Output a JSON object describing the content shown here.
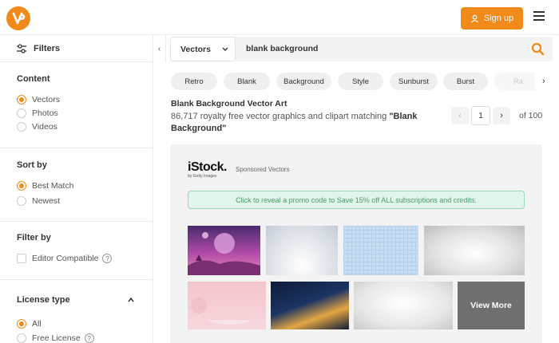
{
  "header": {
    "logo_icon": "vecteezy-v-logo-icon",
    "signup_label": "Sign up",
    "signup_icon": "user-icon",
    "menu_icon": "hamburger-menu-icon",
    "accent_color": "#f28a1a"
  },
  "sidebar": {
    "filters_label": "Filters",
    "collapse_icon": "chevron-left-icon",
    "content": {
      "title": "Content",
      "options": [
        {
          "label": "Vectors",
          "selected": true
        },
        {
          "label": "Photos",
          "selected": false
        },
        {
          "label": "Videos",
          "selected": false
        }
      ]
    },
    "sort": {
      "title": "Sort by",
      "options": [
        {
          "label": "Best Match",
          "selected": true
        },
        {
          "label": "Newest",
          "selected": false
        }
      ]
    },
    "filter_by": {
      "title": "Filter by",
      "option": "Editor Compatible",
      "checked": false
    },
    "license": {
      "title": "License type",
      "options": [
        {
          "label": "All",
          "selected": true
        },
        {
          "label": "Free License",
          "selected": false
        }
      ]
    }
  },
  "search": {
    "type_label": "Vectors",
    "query": "blank background",
    "search_icon": "search-icon"
  },
  "tags": [
    "Retro",
    "Blank",
    "Background",
    "Style",
    "Sunburst",
    "Burst",
    "Ra"
  ],
  "results": {
    "title": "Blank Background Vector Art",
    "subtitle_prefix": "86,717 royalty free vector graphics and clipart matching ",
    "subtitle_query": "\"Blank Background\"",
    "page": "1",
    "page_total": "of 100"
  },
  "sponsored": {
    "brand": "iStock.",
    "brand_sub": "by Getty Images",
    "label": "Sponsored Vectors",
    "promo": "Click to reveal a promo code to Save 15% off ALL subscriptions and credits.",
    "view_more": "View More"
  }
}
